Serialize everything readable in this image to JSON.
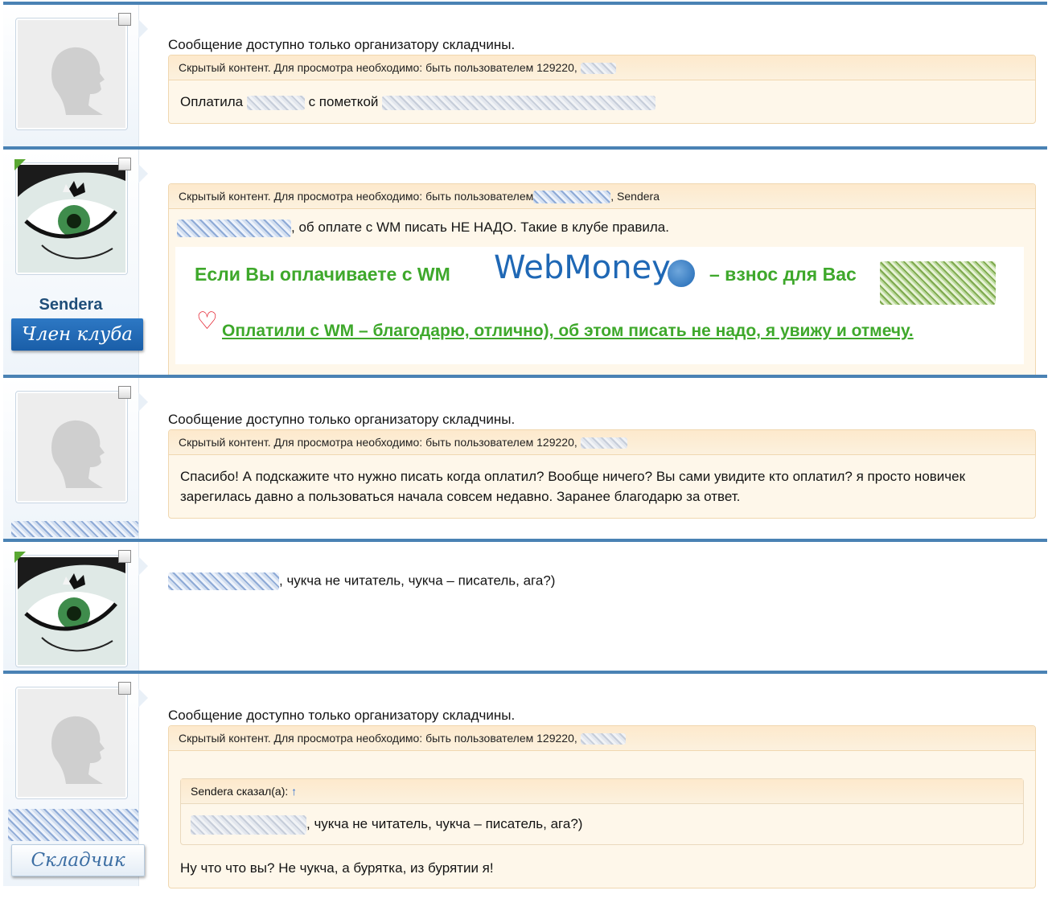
{
  "common": {
    "organizer_only": "Сообщение доступно только организатору складчины.",
    "hidden_prefix": "Скрытый контент. Для просмотра необходимо: быть пользователем 129220,",
    "hidden_prefix_short": "Скрытый контент. Для просмотра необходимо: быть пользователем"
  },
  "posts": [
    {
      "body_a": "Оплатила",
      "body_b": "с пометкой"
    },
    {
      "username": "Sendera",
      "user_title": "Член клуба",
      "hidden_suffix": ", Sendera",
      "text": ", об оплате с WM писать НЕ НАДО. Такие в клубе правила.",
      "banner": {
        "line1": "Если Вы оплачиваете с WM",
        "logo": "WebMoney",
        "line1b": "– взнос для Вас",
        "heart": "♡",
        "line2": "Оплатили с WM – благодарю, отлично), об этом писать не надо, я увижу и отмечу."
      }
    },
    {
      "body": "Спасибо! А подскажите что нужно писать когда оплатил? Вообще ничего? Вы сами увидите кто оплатил? я просто новичек зарегилась давно а пользоваться начала совсем недавно. Заранее благодарю за ответ."
    },
    {
      "text": ", чукча не читатель, чукча – писатель, ага?)"
    },
    {
      "user_title": "Складчик",
      "quote_author": "Sendera сказал(а):",
      "quote_arrow": "↑",
      "quote_text": ", чукча не читатель, чукча – писатель, ага?)",
      "reply": "Ну что что вы? Не чукча, а бурятка, из бурятии я!"
    }
  ]
}
